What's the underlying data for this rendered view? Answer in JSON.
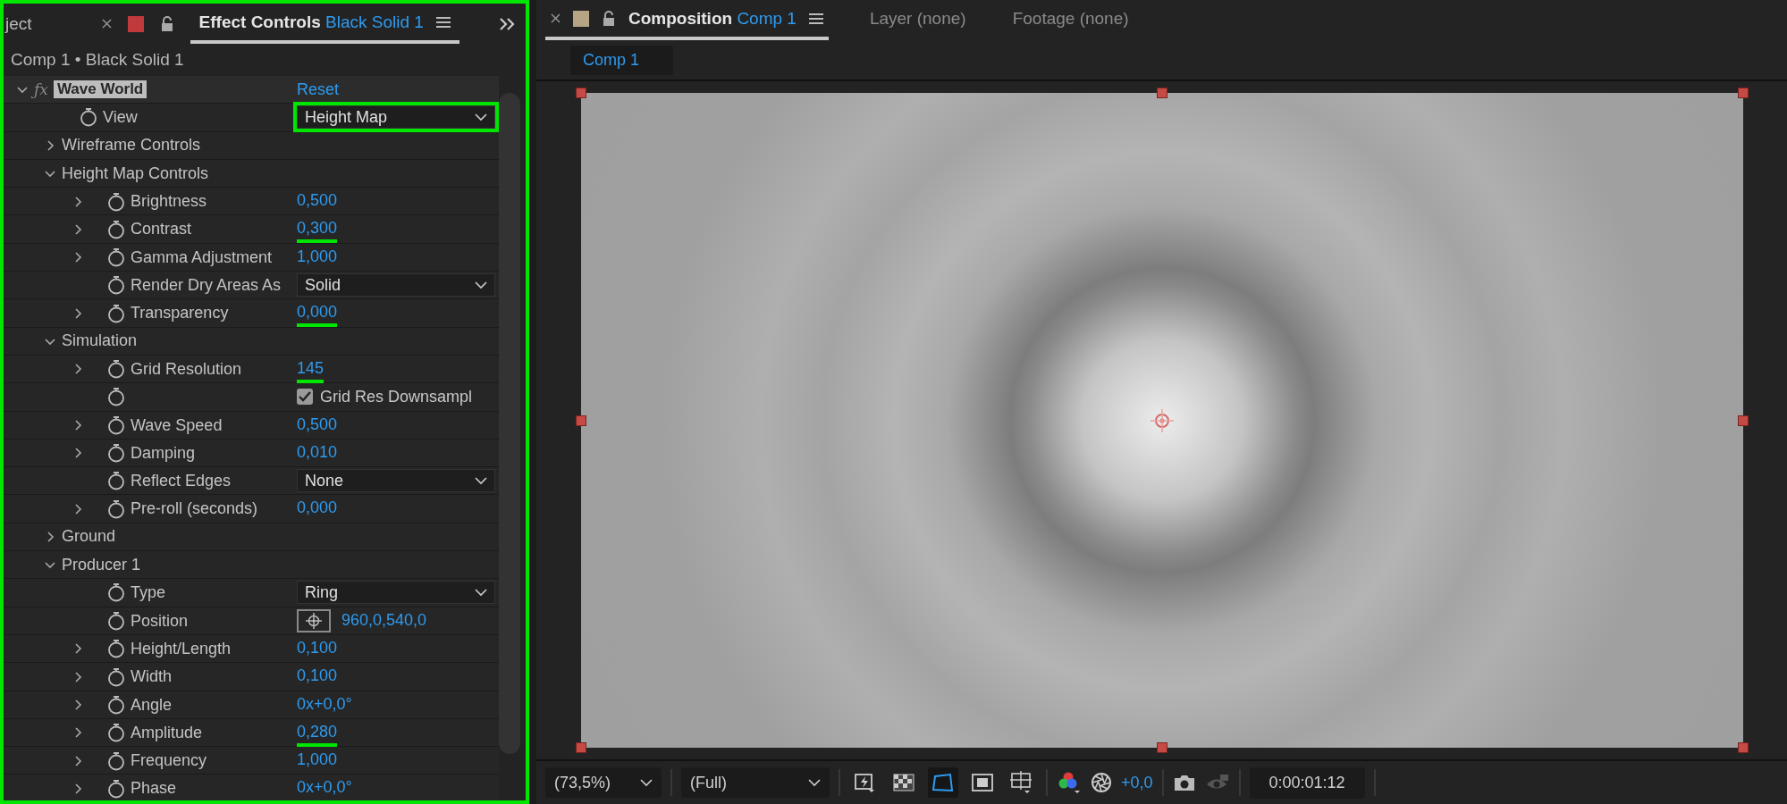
{
  "left_panel": {
    "highlighted": true,
    "cut_tab": {
      "label": "ject"
    },
    "tab": {
      "label": "Effect Controls",
      "target": "Black Solid 1",
      "selected": true
    },
    "breadcrumb": "Comp 1 • Black Solid 1",
    "effect": {
      "badge": "ƒx",
      "name": "Wave World",
      "reset": "Reset",
      "expanded": true,
      "children": [
        {
          "kind": "dropdown",
          "name": "View",
          "value": "Height Map",
          "highlighted": true
        },
        {
          "kind": "group",
          "name": "Wireframe Controls",
          "expanded": false
        },
        {
          "kind": "group",
          "name": "Height Map Controls",
          "expanded": true,
          "children": [
            {
              "kind": "number",
              "name": "Brightness",
              "value": "0,500",
              "highlighted": false
            },
            {
              "kind": "number",
              "name": "Contrast",
              "value": "0,300",
              "highlighted": true
            },
            {
              "kind": "number",
              "name": "Gamma Adjustment",
              "value": "1,000",
              "highlighted": false
            },
            {
              "kind": "dropdown",
              "name": "Render Dry Areas As",
              "value": "Solid",
              "highlighted": false
            },
            {
              "kind": "number",
              "name": "Transparency",
              "value": "0,000",
              "highlighted": true
            }
          ]
        },
        {
          "kind": "group",
          "name": "Simulation",
          "expanded": true,
          "children": [
            {
              "kind": "number",
              "name": "Grid Resolution",
              "value": "145",
              "highlighted": true
            },
            {
              "kind": "checkbox",
              "label": "Grid Res Downsampl",
              "checked": true,
              "highlighted": false
            },
            {
              "kind": "number",
              "name": "Wave Speed",
              "value": "0,500",
              "highlighted": false
            },
            {
              "kind": "number",
              "name": "Damping",
              "value": "0,010",
              "highlighted": false
            },
            {
              "kind": "dropdown",
              "name": "Reflect Edges",
              "value": "None",
              "highlighted": false
            },
            {
              "kind": "number",
              "name": "Pre-roll (seconds)",
              "value": "0,000",
              "highlighted": false
            }
          ]
        },
        {
          "kind": "group",
          "name": "Ground",
          "expanded": false
        },
        {
          "kind": "group",
          "name": "Producer 1",
          "expanded": true,
          "children": [
            {
              "kind": "dropdown",
              "name": "Type",
              "value": "Ring",
              "highlighted": false
            },
            {
              "kind": "point",
              "name": "Position",
              "value": "960,0,540,0",
              "highlighted": false
            },
            {
              "kind": "number",
              "name": "Height/Length",
              "value": "0,100",
              "highlighted": false
            },
            {
              "kind": "number",
              "name": "Width",
              "value": "0,100",
              "highlighted": false
            },
            {
              "kind": "number",
              "name": "Angle",
              "value": "0x+0,0°",
              "highlighted": false
            },
            {
              "kind": "number",
              "name": "Amplitude",
              "value": "0,280",
              "highlighted": true
            },
            {
              "kind": "number",
              "name": "Frequency",
              "value": "1,000",
              "highlighted": false
            },
            {
              "kind": "number",
              "name": "Phase",
              "value": "0x+0,0°",
              "highlighted": false
            }
          ]
        }
      ]
    }
  },
  "right_panel": {
    "tabs": [
      {
        "label": "Composition",
        "target": "Comp 1",
        "selected": true
      },
      {
        "label": "Layer (none)",
        "selected": false
      },
      {
        "label": "Footage (none)",
        "selected": false
      }
    ],
    "breadcrumb": "Comp 1",
    "toolbar": {
      "zoom": "(73,5%)",
      "resolution": "(Full)",
      "tools": [
        {
          "kind": "fast-preview",
          "selected": false
        },
        {
          "kind": "transparency-grid",
          "selected": false
        },
        {
          "kind": "mask-path",
          "selected": true
        },
        {
          "kind": "region",
          "selected": false
        },
        {
          "kind": "guides",
          "selected": false
        }
      ],
      "exposure": "+0,0",
      "timecode": "0:00:01:12"
    }
  }
}
